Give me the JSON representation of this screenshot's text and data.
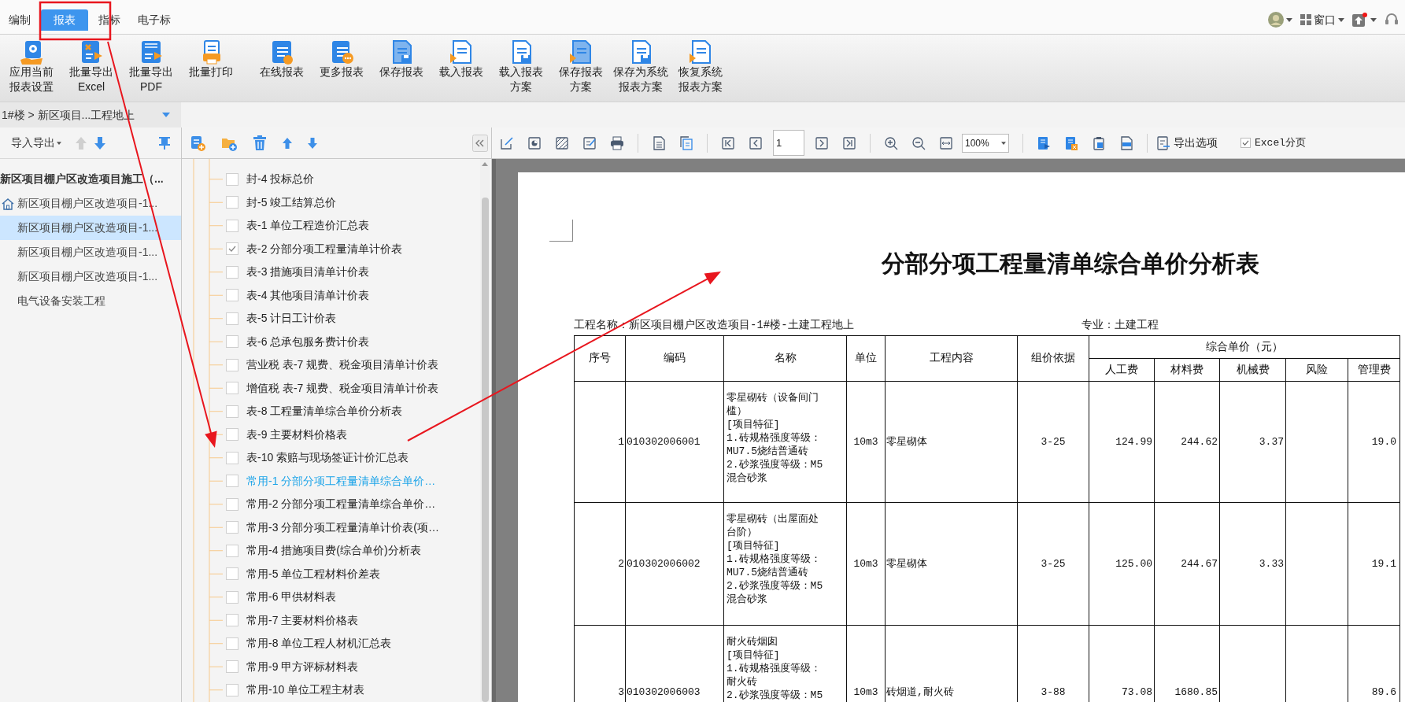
{
  "menu_tabs": [
    {
      "label": "编制",
      "selected": false
    },
    {
      "label": "报表",
      "selected": true
    },
    {
      "label": "指标",
      "selected": false
    },
    {
      "label": "电子标",
      "selected": false
    }
  ],
  "top_right": {
    "window_menu": "窗口"
  },
  "toolbar": [
    {
      "lines": [
        "应用当前",
        "报表设置"
      ]
    },
    {
      "lines": [
        "批量导出",
        "Excel"
      ]
    },
    {
      "lines": [
        "批量导出",
        "PDF"
      ]
    },
    {
      "lines": [
        "批量打印"
      ]
    },
    {
      "lines": [
        "在线报表"
      ]
    },
    {
      "lines": [
        "更多报表"
      ]
    },
    {
      "lines": [
        "保存报表"
      ]
    },
    {
      "lines": [
        "载入报表"
      ]
    },
    {
      "lines": [
        "载入报表",
        "方案"
      ]
    },
    {
      "lines": [
        "保存报表",
        "方案"
      ]
    },
    {
      "lines": [
        "保存为系统",
        "报表方案"
      ]
    },
    {
      "lines": [
        "恢复系统",
        "报表方案"
      ]
    }
  ],
  "breadcrumb": "1#楼 > 新区项目...工程地上",
  "left_panel": {
    "menu": "导入导出",
    "tree": {
      "label": "新区项目棚户区改造项目施工（...",
      "children": [
        {
          "label": "新区项目棚户区改造项目-1...",
          "kind": "home",
          "selected": false
        },
        {
          "label": "新区项目棚户区改造项目-1...",
          "kind": "unit",
          "selected": true
        },
        {
          "label": "新区项目棚户区改造项目-1...",
          "kind": "unit",
          "selected": false
        },
        {
          "label": "新区项目棚户区改造项目-1...",
          "kind": "unit",
          "selected": false
        },
        {
          "label": "电气设备安装工程",
          "kind": "unit",
          "selected": false
        }
      ]
    }
  },
  "report_list": [
    {
      "label": "封-4 投标总价",
      "checked": false,
      "selected": false
    },
    {
      "label": "封-5 竣工结算总价",
      "checked": false,
      "selected": false
    },
    {
      "label": "表-1 单位工程造价汇总表",
      "checked": false,
      "selected": false
    },
    {
      "label": "表-2 分部分项工程量清单计价表",
      "checked": true,
      "selected": false
    },
    {
      "label": "表-3 措施项目清单计价表",
      "checked": false,
      "selected": false
    },
    {
      "label": "表-4 其他项目清单计价表",
      "checked": false,
      "selected": false
    },
    {
      "label": "表-5 计日工计价表",
      "checked": false,
      "selected": false
    },
    {
      "label": "表-6 总承包服务费计价表",
      "checked": false,
      "selected": false
    },
    {
      "label": "营业税 表-7 规费、税金项目清单计价表",
      "checked": false,
      "selected": false
    },
    {
      "label": "增值税 表-7 规费、税金项目清单计价表",
      "checked": false,
      "selected": false
    },
    {
      "label": "表-8 工程量清单综合单价分析表",
      "checked": false,
      "selected": false
    },
    {
      "label": "表-9 主要材料价格表",
      "checked": false,
      "selected": false
    },
    {
      "label": "表-10 索赔与现场签证计价汇总表",
      "checked": false,
      "selected": false
    },
    {
      "label": "常用-1 分部分项工程量清单综合单价…",
      "checked": false,
      "selected": true
    },
    {
      "label": "常用-2 分部分项工程量清单综合单价…",
      "checked": false,
      "selected": false
    },
    {
      "label": "常用-3 分部分项工程量清单计价表(项…",
      "checked": false,
      "selected": false
    },
    {
      "label": "常用-4 措施项目费(综合单价)分析表",
      "checked": false,
      "selected": false
    },
    {
      "label": "常用-5 单位工程材料价差表",
      "checked": false,
      "selected": false
    },
    {
      "label": "常用-6 甲供材料表",
      "checked": false,
      "selected": false
    },
    {
      "label": "常用-7 主要材料价格表",
      "checked": false,
      "selected": false
    },
    {
      "label": "常用-8 单位工程人材机汇总表",
      "checked": false,
      "selected": false
    },
    {
      "label": "常用-9 甲方评标材料表",
      "checked": false,
      "selected": false
    },
    {
      "label": "常用-10 单位工程主材表",
      "checked": false,
      "selected": false
    }
  ],
  "viewer": {
    "page_number": "1",
    "zoom": "100%",
    "export_options": "导出选项",
    "excel_paging": {
      "label": "Excel分页",
      "checked": true
    }
  },
  "report": {
    "title": "分部分项工程量清单综合单价分析表",
    "project_name": "工程名称：新区项目棚户区改造项目-1#楼-土建工程地上",
    "specialty": "专业：土建工程",
    "columns": [
      "序号",
      "编码",
      "名称",
      "单位",
      "工程内容",
      "组价依据"
    ],
    "group_header": "综合单价（元）",
    "sub_columns": [
      "人工费",
      "材料费",
      "机械费",
      "风险",
      "管理费"
    ],
    "rows": [
      {
        "no": "1",
        "code": "010302006001",
        "name_lines": [
          "零星砌砖（设备间门",
          "槛）",
          "[项目特征]",
          "1.砖规格强度等级：",
          "MU7.5烧结普通砖",
          "2.砂浆强度等级：M5",
          "混合砂浆"
        ],
        "unit": "10m3",
        "content": "零星砌体",
        "basis": "3-25",
        "labor": "124.99",
        "material": "244.62",
        "machine": "3.37",
        "risk": "",
        "mgmt": "19.0"
      },
      {
        "no": "2",
        "code": "010302006002",
        "name_lines": [
          "零星砌砖（出屋面处",
          "台阶）",
          "[项目特征]",
          "1.砖规格强度等级：",
          "MU7.5烧结普通砖",
          "2.砂浆强度等级：M5",
          "混合砂浆"
        ],
        "unit": "10m3",
        "content": "零星砌体",
        "basis": "3-25",
        "labor": "125.00",
        "material": "244.67",
        "machine": "3.33",
        "risk": "",
        "mgmt": "19.1"
      },
      {
        "no": "3",
        "code": "010302006003",
        "name_lines": [
          "耐火砖烟囱",
          "[项目特征]",
          "1.砖规格强度等级：",
          "耐火砖",
          "2.砂浆强度等级：M5"
        ],
        "unit": "10m3",
        "content": "砖烟道,耐火砖",
        "basis": "3-88",
        "labor": "73.08",
        "material": "1680.85",
        "machine": "",
        "risk": "",
        "mgmt": "89.6"
      }
    ]
  }
}
